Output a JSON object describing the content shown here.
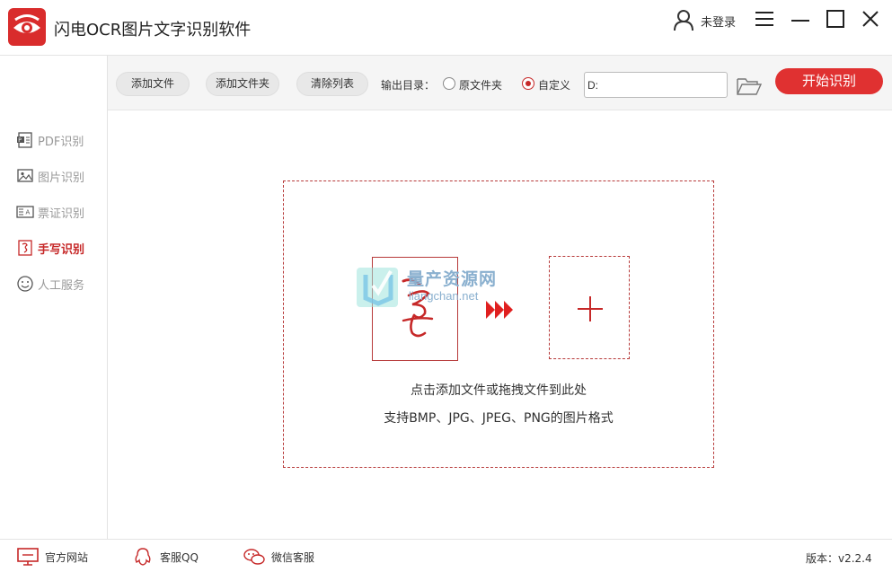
{
  "app": {
    "title": "闪电OCR图片文字识别软件",
    "brand_color": "#d92c2c"
  },
  "titlebar": {
    "user_label": "未登录"
  },
  "sidebar": {
    "items": [
      {
        "label": "PDF识别",
        "icon": "pdf-icon",
        "active": false
      },
      {
        "label": "图片识别",
        "icon": "image-icon",
        "active": false
      },
      {
        "label": "票证识别",
        "icon": "id-card-icon",
        "active": false
      },
      {
        "label": "手写识别",
        "icon": "handwriting-icon",
        "active": true
      },
      {
        "label": "人工服务",
        "icon": "smiley-icon",
        "active": false
      }
    ]
  },
  "toolbar": {
    "add_file": "添加文件",
    "add_folder": "添加文件夹",
    "clear_list": "清除列表",
    "output_label": "输出目录：",
    "radio_original": "原文件夹",
    "radio_custom": "自定义",
    "radio_selected": "自定义",
    "path_value": "D:",
    "start_button": "开始识别"
  },
  "dropzone": {
    "hint_line1": "点击添加文件或拖拽文件到此处",
    "hint_line2": "支持BMP、JPG、JPEG、PNG的图片格式"
  },
  "watermark": {
    "text": "量产资源网",
    "domain": "liangchan.net"
  },
  "bottombar": {
    "official_site": "官方网站",
    "qq_service": "客服QQ",
    "wechat_service": "微信客服",
    "version": "版本：v2.2.4"
  }
}
